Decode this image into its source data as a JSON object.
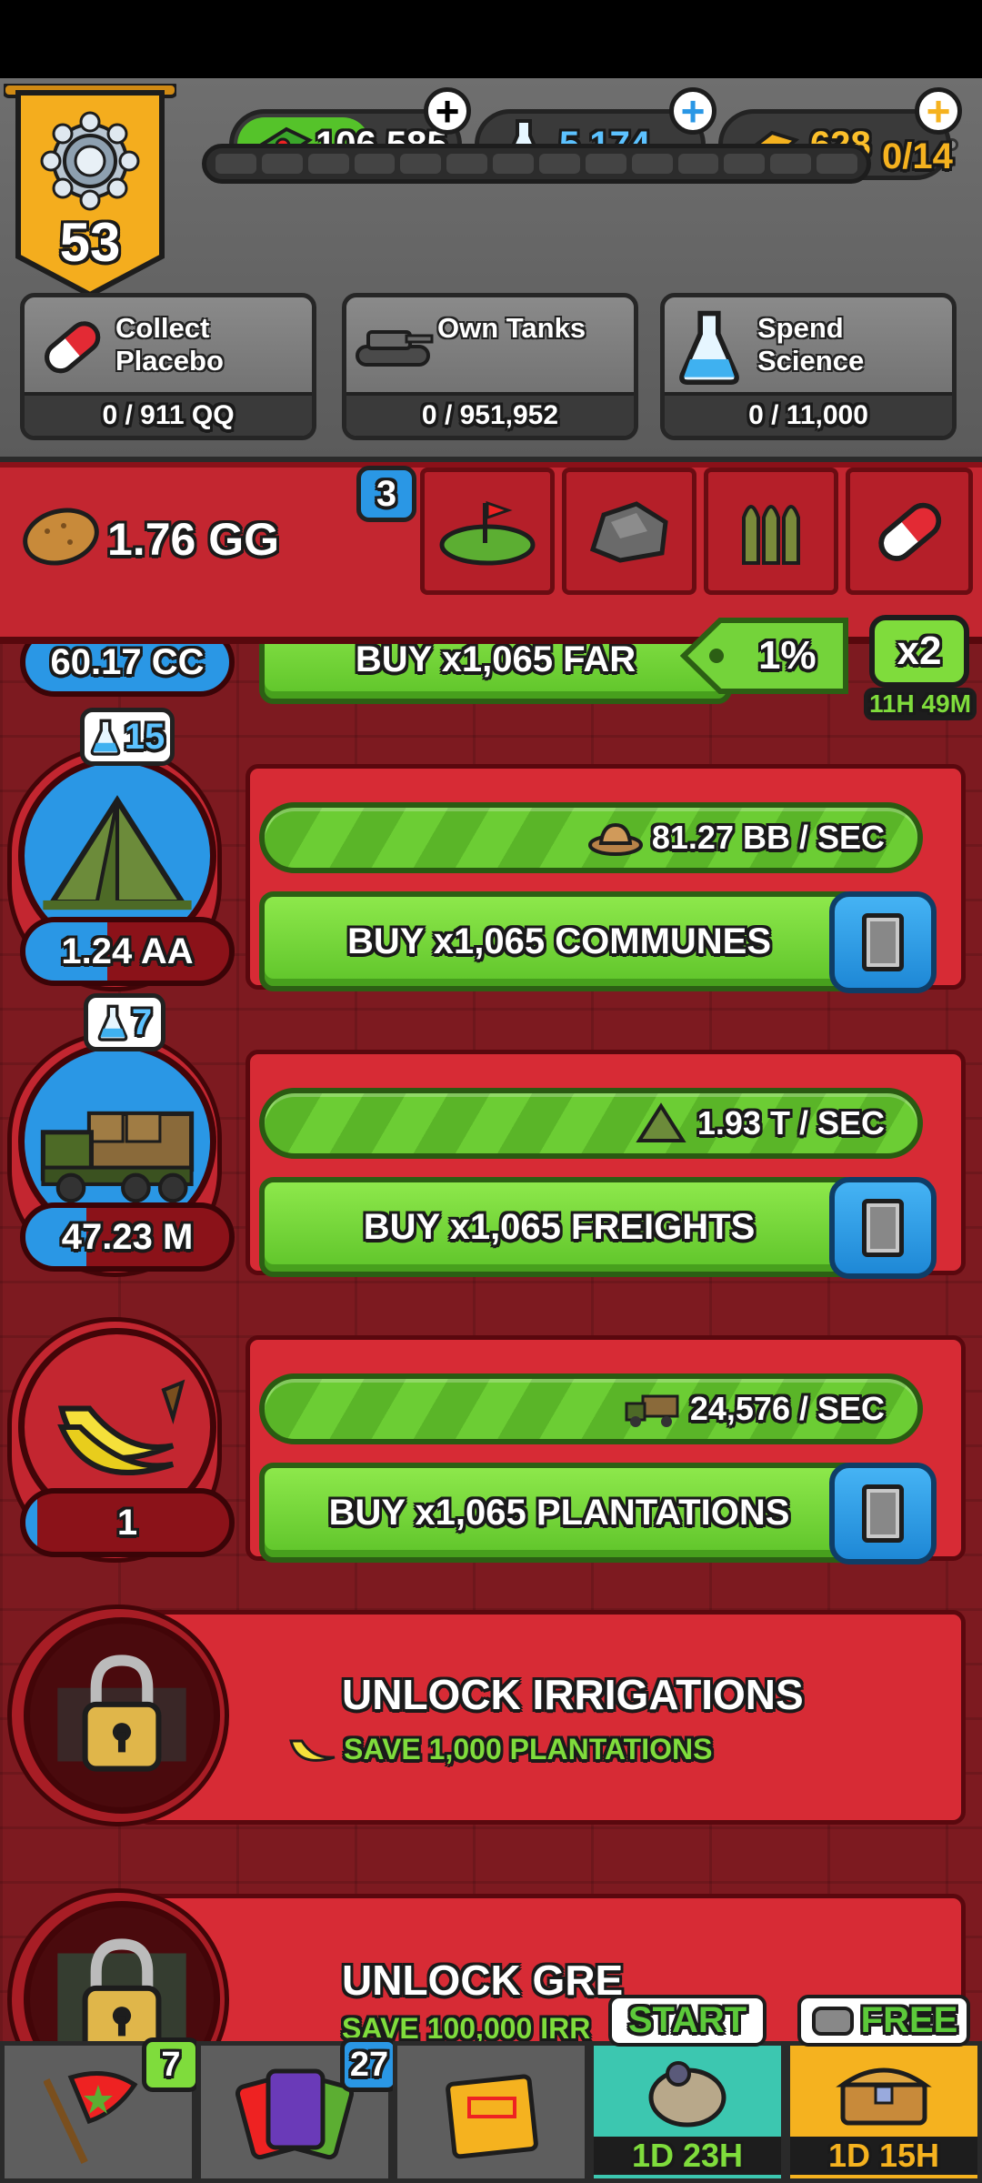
{
  "resources": {
    "cash": "106,585",
    "science": "5,174",
    "gold": "628"
  },
  "level": {
    "number": "53",
    "progress": "0/14"
  },
  "missions": [
    {
      "title_line1": "Collect",
      "title_line2": "Placebo",
      "progress": "0 / 911 QQ",
      "icon": "pill-icon"
    },
    {
      "title_line1": "Own Tanks",
      "title_line2": "",
      "progress": "0 / 951,952",
      "icon": "tank-icon"
    },
    {
      "title_line1": "Spend",
      "title_line2": "Science",
      "progress": "0 / 11,000",
      "icon": "flask-icon"
    }
  ],
  "category": {
    "amount": "1.76 GG",
    "badge": "3",
    "tabs": [
      "farm-tab",
      "ore-tab",
      "ammo-tab",
      "medicine-tab"
    ]
  },
  "partial_row": {
    "owned": "60.17 CC",
    "buy_label": "BUY x1,065 FAR",
    "bonus_percent": "1%",
    "multiplier": "x2",
    "timer": "11H 49M"
  },
  "generators": [
    {
      "name": "communes",
      "science": "15",
      "rate": "81.27 BB / SEC",
      "owned": "1.24 AA",
      "owned_fill": 0.4,
      "buy_label": "BUY x1,065 COMMUNES",
      "circle_color": "#2a97e5"
    },
    {
      "name": "freights",
      "science": "7",
      "rate": "1.93 T / SEC",
      "owned": "47.23 M",
      "owned_fill": 0.3,
      "buy_label": "BUY x1,065 FREIGHTS",
      "circle_color": "#2a97e5"
    },
    {
      "name": "plantations",
      "science": "",
      "rate": "24,576 / SEC",
      "owned": "1",
      "owned_fill": 0.06,
      "buy_label": "BUY x1,065 PLANTATIONS",
      "circle_color": "#c32630"
    }
  ],
  "locked": [
    {
      "title": "UNLOCK IRRIGATIONS",
      "requirement": "SAVE 1,000 PLANTATIONS"
    },
    {
      "title": "UNLOCK GRE",
      "requirement": "SAVE 100,000 IRR"
    }
  ],
  "bottom_nav": {
    "flag_badge": "7",
    "cards_badge": "27",
    "start_label": "START",
    "start_timer": "1D 23H",
    "free_label": "FREE",
    "free_timer": "1D 15H"
  },
  "colors": {
    "gold": "#f5b21f",
    "green": "#7fdc3c",
    "blue": "#2a97e5",
    "red": "#c32630"
  }
}
